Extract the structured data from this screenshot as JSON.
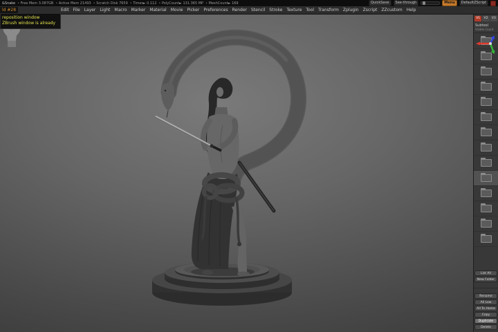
{
  "status_bar": {
    "project": "&Snake",
    "stats": [
      "Free Mem 3.087GB",
      "Active Mem 21493",
      "Scratch Disk 7659",
      "Timer► 0.112",
      "PolyCount► 131.365 MP",
      "MeshCount► 169"
    ],
    "quicksave_label": "QuickSave",
    "see_through_label": "See-through",
    "menu_label": "Menu",
    "zscript_label": "DefaultZScript"
  },
  "menu_bar": {
    "items": [
      "Edit",
      "File",
      "Layer",
      "Light",
      "Macro",
      "Marker",
      "Material",
      "Movie",
      "Picker",
      "Preferences",
      "Render",
      "Stencil",
      "Stroke",
      "Texture",
      "Tool",
      "Transform",
      "Zplugin",
      "Zscript",
      "ZZcustom",
      "Help"
    ]
  },
  "notification": {
    "title": "ld #28",
    "lines": [
      "reposition window",
      "ZBrush window is already"
    ]
  },
  "subtool_panel": {
    "tabs": [
      "V1",
      "V2",
      "V3"
    ],
    "active_tab": "V1",
    "title": "Subtool",
    "subtitle": "Visible Count",
    "folders": 14,
    "selected_folder": 9,
    "top_buttons": [
      "List All",
      "New Folder"
    ],
    "bottom_buttons": [
      "Rename",
      "All Low",
      "All To Home",
      "Copy",
      "Duplicate",
      "Delete"
    ],
    "active_button": "Duplicate"
  },
  "canvas": {
    "description": "Samurai figure with long hair holding a katana, giant snake coiling overhead, standing on a round pedestal",
    "axis_colors": {
      "x": "#e03a2e",
      "y": "#35b53a",
      "z": "#3546e0"
    }
  },
  "colors": {
    "menu_highlight": "#c57a2c",
    "notification_title": "#d08a2e",
    "notification_text": "#e2e24e",
    "tab_active": "#b03a28"
  }
}
